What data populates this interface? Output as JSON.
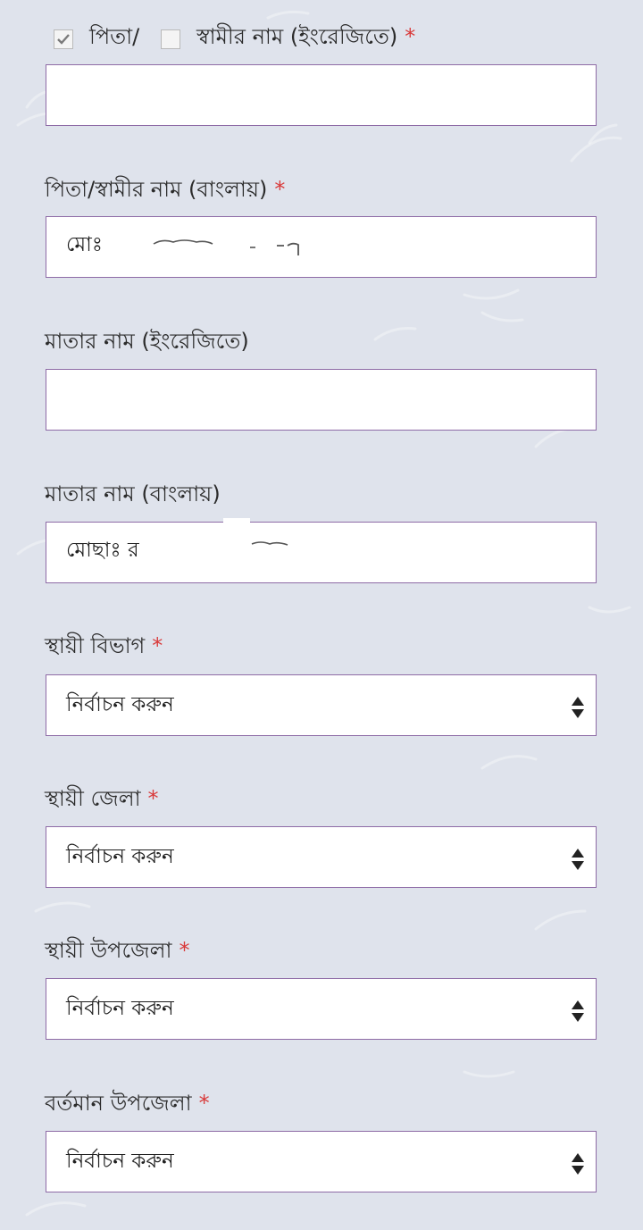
{
  "colors": {
    "background": "#dfe3ec",
    "border": "#8e6ba6",
    "required": "#d93a3a"
  },
  "father_husband_checkbox": {
    "father_label": "পিতা/",
    "father_checked": true,
    "husband_label": "স্বামীর নাম (ইংরেজিতে)",
    "husband_checked": false,
    "required_mark": "*"
  },
  "fields": {
    "father_name_en": {
      "value": ""
    },
    "father_name_bn": {
      "label": "পিতা/স্বামীর নাম (বাংলায়)",
      "required_mark": "*",
      "value": "মোঃ"
    },
    "mother_name_en": {
      "label": "মাতার নাম (ইংরেজিতে)",
      "value": ""
    },
    "mother_name_bn": {
      "label": "মাতার নাম (বাংলায়)",
      "value": "মোছাঃ র"
    },
    "permanent_division": {
      "label": "স্থায়ী বিভাগ",
      "required_mark": "*",
      "selected": "নির্বাচন করুন"
    },
    "permanent_district": {
      "label": "স্থায়ী জেলা",
      "required_mark": "*",
      "selected": "নির্বাচন করুন"
    },
    "permanent_upazila": {
      "label": "স্থায়ী উপজেলা",
      "required_mark": "*",
      "selected": "নির্বাচন করুন"
    },
    "present_upazila": {
      "label": "বর্তমান উপজেলা",
      "required_mark": "*",
      "selected": "নির্বাচন করুন"
    }
  }
}
